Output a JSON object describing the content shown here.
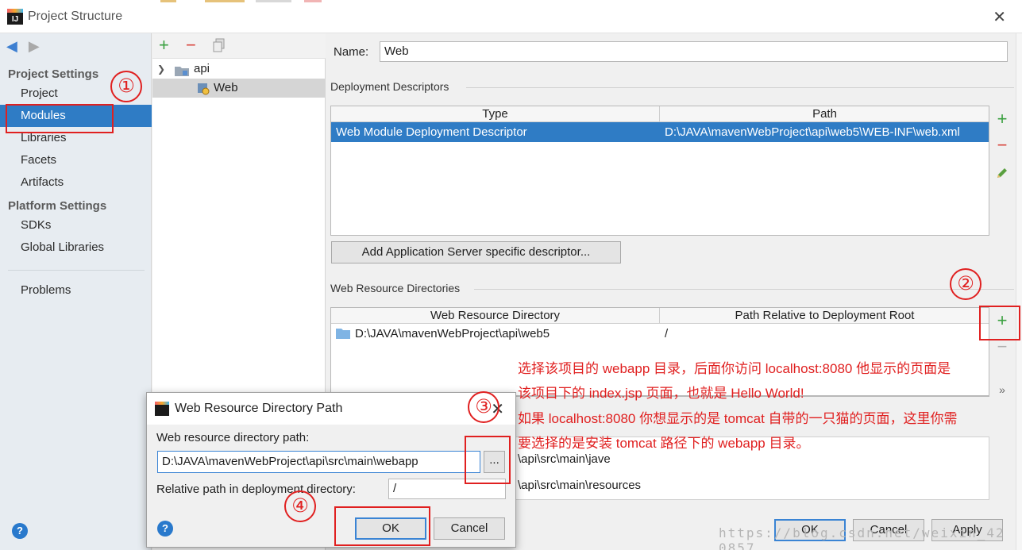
{
  "window": {
    "title": "Project Structure",
    "close_glyph": "✕"
  },
  "sidebar": {
    "project_settings_title": "Project Settings",
    "project_items": [
      "Project",
      "Modules",
      "Libraries",
      "Facets",
      "Artifacts"
    ],
    "platform_settings_title": "Platform Settings",
    "platform_items": [
      "SDKs",
      "Global Libraries"
    ],
    "problems": "Problems",
    "help": "?"
  },
  "tree": {
    "add": "+",
    "remove": "−",
    "root": "api",
    "child": "Web"
  },
  "facet": {
    "name_label": "Name:",
    "name_value": "Web",
    "deployment_title": "Deployment Descriptors",
    "dd_columns": [
      "Type",
      "Path"
    ],
    "dd_rows": [
      {
        "type": "Web Module Deployment Descriptor",
        "path": "D:\\JAVA\\mavenWebProject\\api\\web5\\WEB-INF\\web.xml"
      }
    ],
    "add_server_btn": "Add Application Server specific descriptor...",
    "web_res_title": "Web Resource Directories",
    "wr_columns": [
      "Web Resource Directory",
      "Path Relative to Deployment Root"
    ],
    "wr_rows": [
      {
        "dir": "D:\\JAVA\\mavenWebProject\\api\\web5",
        "rel": "/"
      }
    ],
    "source_rows": [
      "\\api\\src\\main\\jave",
      "\\api\\src\\main\\resources"
    ],
    "more_glyph": "»"
  },
  "footer": {
    "ok": "OK",
    "cancel": "Cancel",
    "apply": "Apply"
  },
  "dialog": {
    "title": "Web Resource Directory Path",
    "path_label": "Web resource directory path:",
    "path_value": "D:\\JAVA\\mavenWebProject\\api\\src\\main\\webapp",
    "browse": "...",
    "rel_label": "Relative path in deployment directory:",
    "rel_value": "/",
    "ok": "OK",
    "cancel": "Cancel",
    "close_glyph": "✕"
  },
  "annotations": {
    "markers": [
      "①",
      "②",
      "③",
      "④"
    ],
    "lines": [
      "选择该项目的 webapp 目录，后面你访问 localhost:8080 他显示的页面是",
      "该项目下的 index.jsp 页面，也就是 Hello World!",
      "如果 localhost:8080 你想显示的是 tomcat 自带的一只猫的页面，这里你需",
      "要选择的是安装 tomcat 路径下的 webapp 目录。"
    ],
    "watermark": "https://blog.csdn.net/weixin_42  0857"
  },
  "colors": {
    "accent": "#2f7cc5",
    "annotation": "#e02020",
    "add": "#3aa040",
    "remove": "#d8423a"
  }
}
